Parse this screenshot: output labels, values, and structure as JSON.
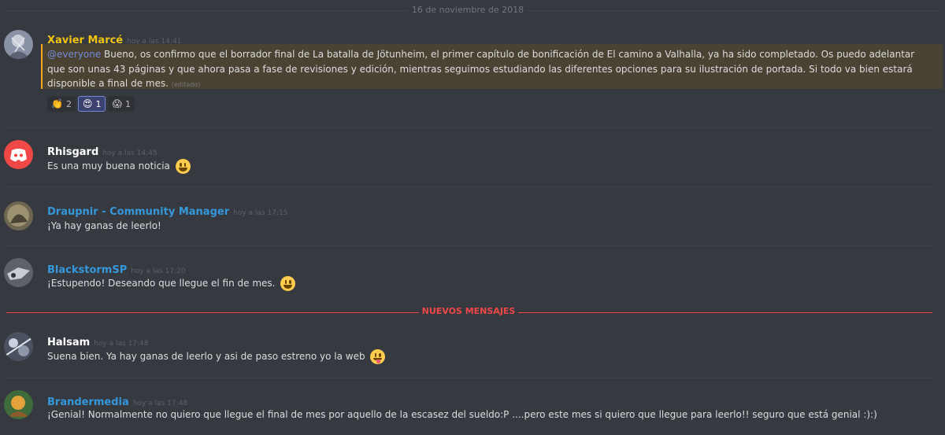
{
  "date_divider": "16 de noviembre de 2018",
  "new_messages_divider": "NUEVOS MENSAJES",
  "colors": {
    "background": "#36393f",
    "mention_highlight": "#4a4233",
    "mention_bar": "#faa61a",
    "mention_text": "#7289da",
    "new_messages": "#f04747"
  },
  "messages": [
    {
      "username": "Xavier Marcé",
      "username_color": "#f1c40f",
      "timestamp": "hoy a las 14:41",
      "mention": "@everyone",
      "text": " Bueno, os confirmo que el borrador final de La batalla de Jötunheim, el primer capítulo de bonificación de El camino a Valhalla, ya ha sido completado. Os puedo adelantar que son unas 43 páginas y que ahora pasa a fase de revisiones y edición, mientras seguimos estudiando las diferentes opciones para su ilustración de portada. Si todo va bien estará disponible a final de mes. ",
      "edited": "(editado)",
      "reactions": [
        {
          "emoji": "👏",
          "icon": "clapping-hands-icon",
          "count": "2"
        },
        {
          "emoji": "😍",
          "icon": "heart-eyes-icon",
          "count": "1"
        },
        {
          "emoji": "😱",
          "icon": "screaming-face-icon",
          "count": "1"
        }
      ]
    },
    {
      "username": "Rhisgard",
      "username_color": "#ffffff",
      "timestamp": "hoy a las 14:45",
      "text": "Es una muy buena noticia",
      "emoji": "smiley-icon"
    },
    {
      "username": "Draupnir - Community Manager",
      "username_color": "#3498db",
      "timestamp": "hoy a las 17:15",
      "text": "¡Ya hay ganas de leerlo!"
    },
    {
      "username": "BlackstormSP",
      "username_color": "#3498db",
      "timestamp": "hoy a las 17:20",
      "text": "¡Estupendo! Deseando que llegue el fin de mes.",
      "emoji": "smiley-icon"
    },
    {
      "username": "Halsam",
      "username_color": "#ffffff",
      "timestamp": "hoy a las 17:48",
      "text": "Suena bien. Ya hay ganas de leerlo y asi de paso estreno yo la web",
      "emoji": "tongue-face-icon"
    },
    {
      "username": "Brandermedia",
      "username_color": "#3498db",
      "timestamp": "hoy a las 17:48",
      "text": "¡Genial! Normalmente no quiero que llegue el final de mes por aquello de la escasez del sueldo:P ....pero este mes si quiero que llegue para leerlo!!  seguro que está genial :):)"
    }
  ]
}
